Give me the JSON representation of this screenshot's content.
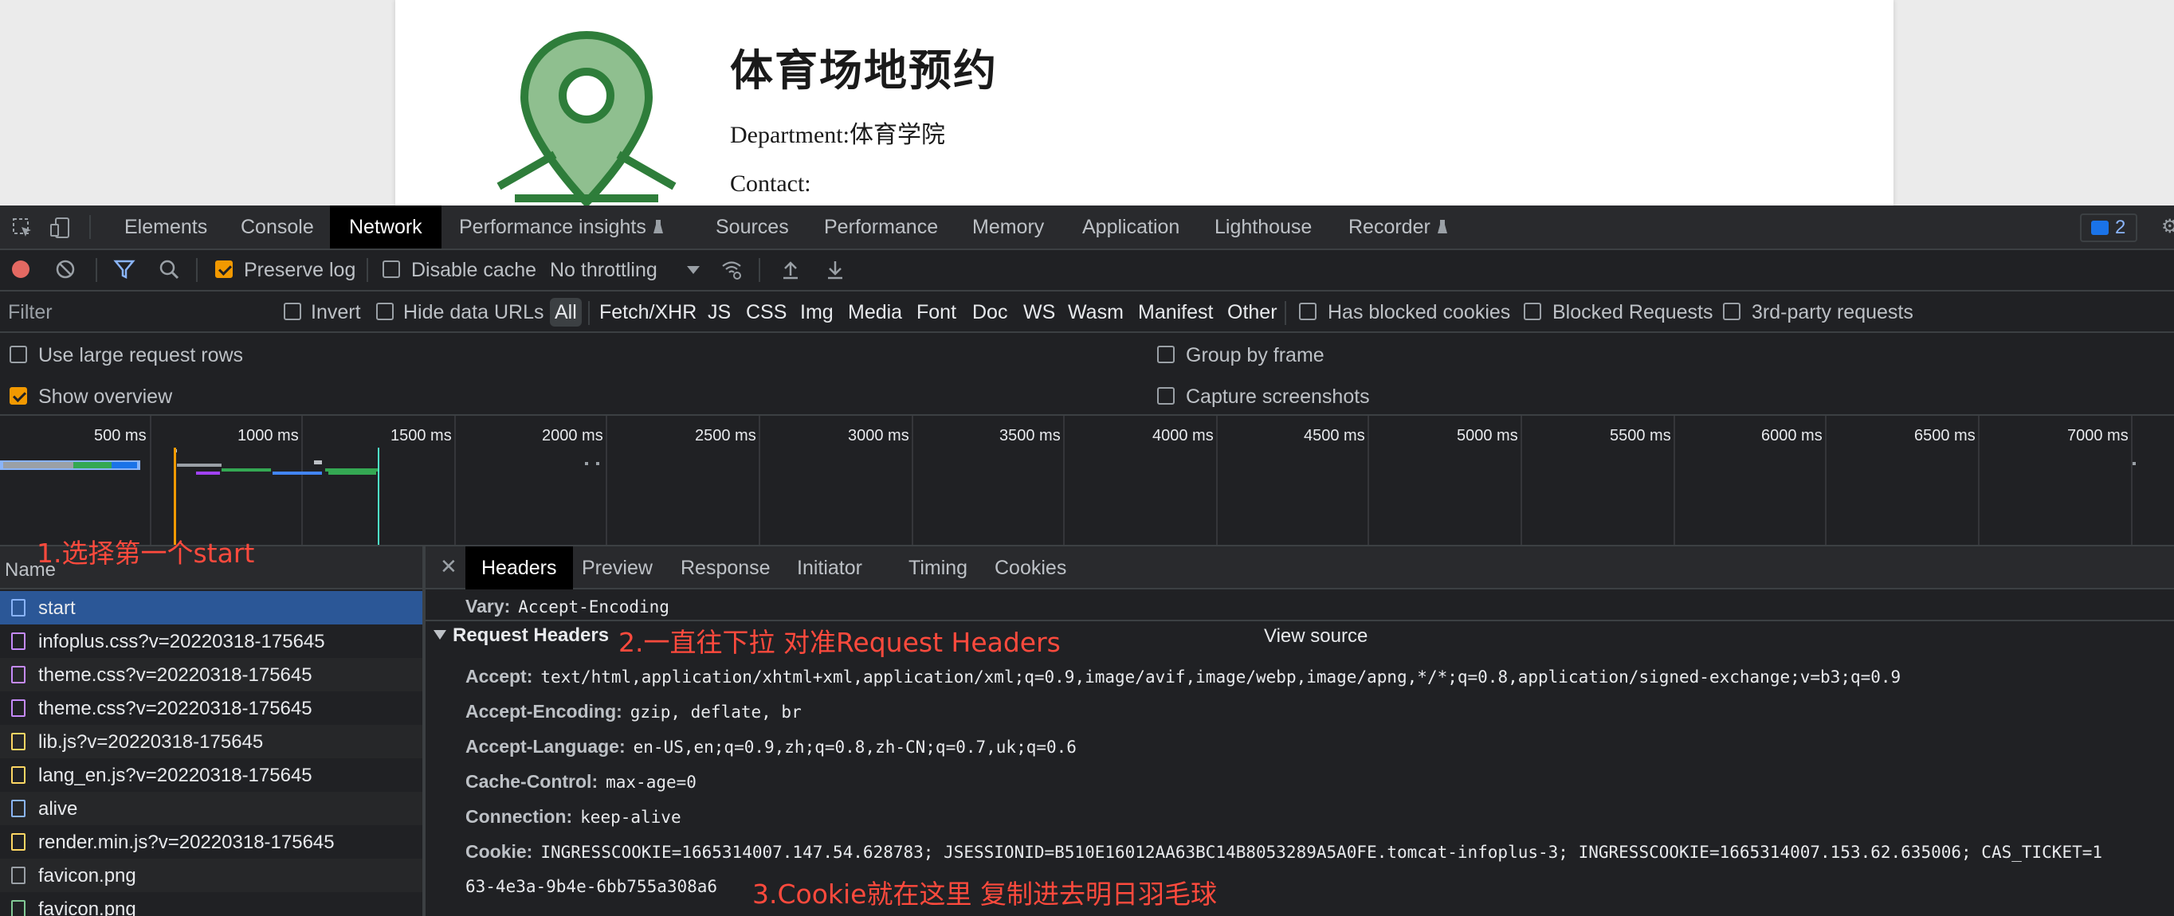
{
  "page": {
    "title": "体育场地预约",
    "department": "Department:体育学院",
    "contact": "Contact:"
  },
  "devtools": {
    "main_tabs": [
      "Elements",
      "Console",
      "Network",
      "Performance insights",
      "Sources",
      "Performance",
      "Memory",
      "Application",
      "Lighthouse",
      "Recorder"
    ],
    "active_tab": "Network",
    "issues_count": "2",
    "toolbar": {
      "preserve_log": "Preserve log",
      "disable_cache": "Disable cache",
      "throttling": "No throttling"
    },
    "filter": {
      "placeholder": "Filter",
      "invert": "Invert",
      "hide_data_urls": "Hide data URLs",
      "types": [
        "All",
        "Fetch/XHR",
        "JS",
        "CSS",
        "Img",
        "Media",
        "Font",
        "Doc",
        "WS",
        "Wasm",
        "Manifest",
        "Other"
      ],
      "has_blocked_cookies": "Has blocked cookies",
      "blocked_requests": "Blocked Requests",
      "third_party": "3rd-party requests"
    },
    "settings": {
      "large_rows": "Use large request rows",
      "show_overview": "Show overview",
      "group_by_frame": "Group by frame",
      "capture_screenshots": "Capture screenshots"
    },
    "overview_ticks": [
      "500 ms",
      "1000 ms",
      "1500 ms",
      "2000 ms",
      "2500 ms",
      "3000 ms",
      "3500 ms",
      "4000 ms",
      "4500 ms",
      "5000 ms",
      "5500 ms",
      "6000 ms",
      "6500 ms",
      "7000 ms"
    ],
    "requests_header": "Name",
    "requests": [
      {
        "name": "start",
        "kind": "doc"
      },
      {
        "name": "infoplus.css?v=20220318-175645",
        "kind": "css"
      },
      {
        "name": "theme.css?v=20220318-175645",
        "kind": "css"
      },
      {
        "name": "theme.css?v=20220318-175645",
        "kind": "css"
      },
      {
        "name": "lib.js?v=20220318-175645",
        "kind": "js"
      },
      {
        "name": "lang_en.js?v=20220318-175645",
        "kind": "js"
      },
      {
        "name": "alive",
        "kind": "doc"
      },
      {
        "name": "render.min.js?v=20220318-175645",
        "kind": "js"
      },
      {
        "name": "favicon.png",
        "kind": "other"
      },
      {
        "name": "favicon.png",
        "kind": "img"
      }
    ],
    "detail_tabs": [
      "Headers",
      "Preview",
      "Response",
      "Initiator",
      "Timing",
      "Cookies"
    ],
    "active_detail_tab": "Headers",
    "vary": {
      "key": "Vary:",
      "value": "Accept-Encoding"
    },
    "request_headers_title": "Request Headers",
    "view_source": "View source",
    "request_headers": [
      {
        "key": "Accept:",
        "value": "text/html,application/xhtml+xml,application/xml;q=0.9,image/avif,image/webp,image/apng,*/*;q=0.8,application/signed-exchange;v=b3;q=0.9"
      },
      {
        "key": "Accept-Encoding:",
        "value": "gzip, deflate, br"
      },
      {
        "key": "Accept-Language:",
        "value": "en-US,en;q=0.9,zh;q=0.8,zh-CN;q=0.7,uk;q=0.6"
      },
      {
        "key": "Cache-Control:",
        "value": "max-age=0"
      },
      {
        "key": "Connection:",
        "value": "keep-alive"
      },
      {
        "key": "Cookie:",
        "value": "INGRESSCOOKIE=1665314007.147.54.628783; JSESSIONID=B510E16012AA63BC14B8053289A5A0FE.tomcat-infoplus-3; INGRESSCOOKIE=1665314007.153.62.635006; CAS_TICKET=1"
      }
    ],
    "cookie_continuation": "63-4e3a-9b4e-6bb755a308a6"
  },
  "annotations": {
    "step1": "1.选择第一个start",
    "step2": "2.一直往下拉 对准Request Headers",
    "step3": "3.Cookie就在这里 复制进去明日羽毛球"
  },
  "colors": {
    "annotation": "#ff4a3d",
    "accent": "#f29900",
    "selected_row": "#2b5797"
  }
}
